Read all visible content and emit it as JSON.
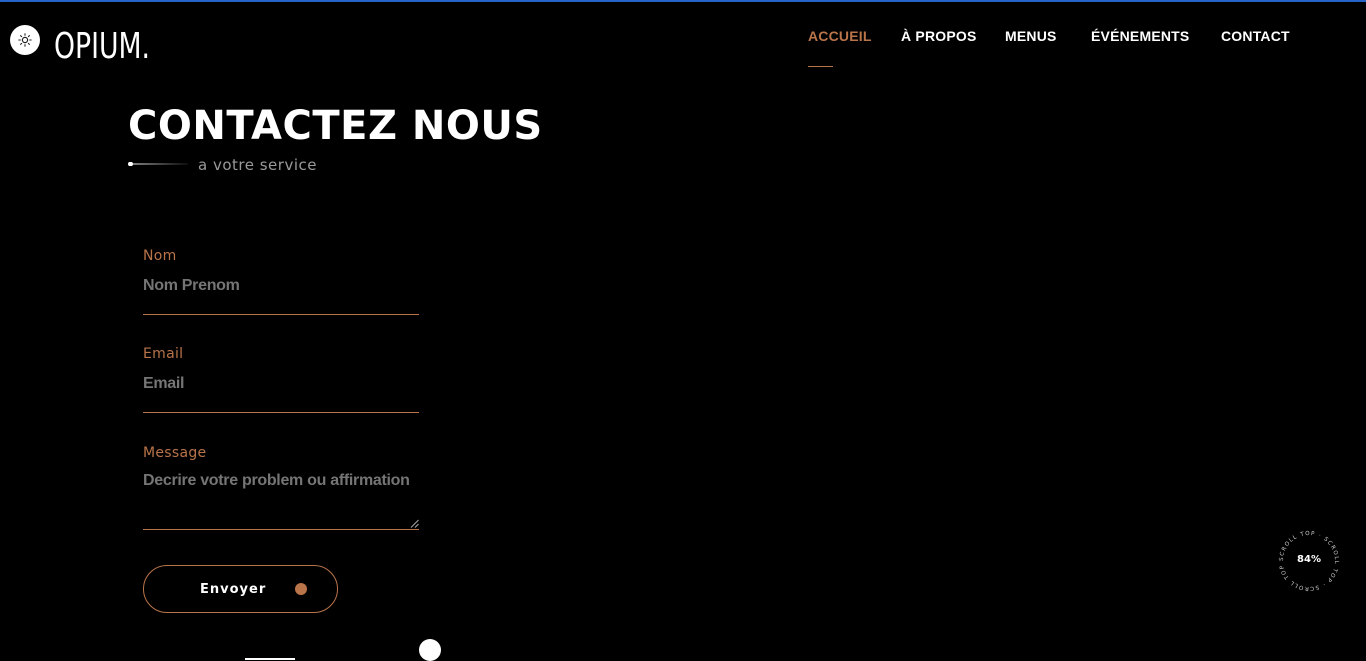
{
  "brand": {
    "logo_text": "OPIUM."
  },
  "nav": {
    "items": [
      {
        "label": "ACCUEIL"
      },
      {
        "label": "À PROPOS"
      },
      {
        "label": "MENUS"
      },
      {
        "label": "ÉVÉNEMENTS"
      },
      {
        "label": "CONTACT"
      }
    ],
    "active": "ACCUEIL"
  },
  "page": {
    "title": "CONTACTEZ NOUS",
    "subtitle": "a votre service"
  },
  "form": {
    "name": {
      "label": "Nom",
      "placeholder": "Nom Prenom"
    },
    "email": {
      "label": "Email",
      "placeholder": "Email"
    },
    "message": {
      "label": "Message",
      "placeholder": "Decrire votre problem ou affirmation"
    },
    "submit_label": "Envoyer"
  },
  "scroll_top": {
    "ring_text": "SCROLL TOP · SCROLL TOP · SCROLL TOP · ",
    "percent": "84%"
  },
  "icons": {
    "theme_toggle": "sun-icon",
    "submit_dot": "dot-icon",
    "resize": "resize-handle-icon"
  },
  "colors": {
    "accent": "#b9744a",
    "background": "#000000",
    "top_bar": "#2563c9"
  }
}
